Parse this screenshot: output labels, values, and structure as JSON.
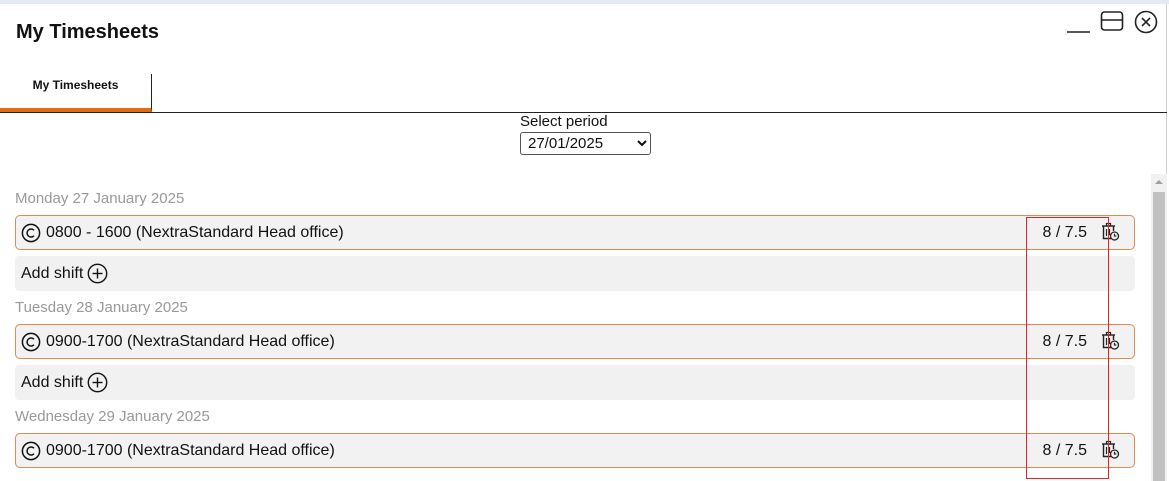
{
  "window": {
    "title": "My Timesheets"
  },
  "tabs": [
    {
      "label": "My Timesheets"
    }
  ],
  "period": {
    "label": "Select period",
    "selected": "27/01/2025"
  },
  "days": [
    {
      "date": "Monday 27 January 2025",
      "shift": "0800 - 1600 (NextraStandard Head office)",
      "hours": "8 / 7.5",
      "add_label": "Add shift"
    },
    {
      "date": "Tuesday 28 January 2025",
      "shift": "0900-1700 (NextraStandard Head office)",
      "hours": "8 / 7.5",
      "add_label": "Add shift"
    },
    {
      "date": "Wednesday 29 January 2025",
      "shift": "0900-1700 (NextraStandard Head office)",
      "hours": "8 / 7.5"
    }
  ],
  "colors": {
    "accent": "#e06c10",
    "row_border": "#e38a4f",
    "highlight": "#e0262b",
    "muted_text": "#999999"
  },
  "icons": {
    "minimize": "minimize-icon",
    "restore": "restore-icon",
    "close": "close-icon",
    "shift": "copyright-circle-icon",
    "delete": "delete-clock-icon",
    "add": "plus-circle-icon"
  }
}
